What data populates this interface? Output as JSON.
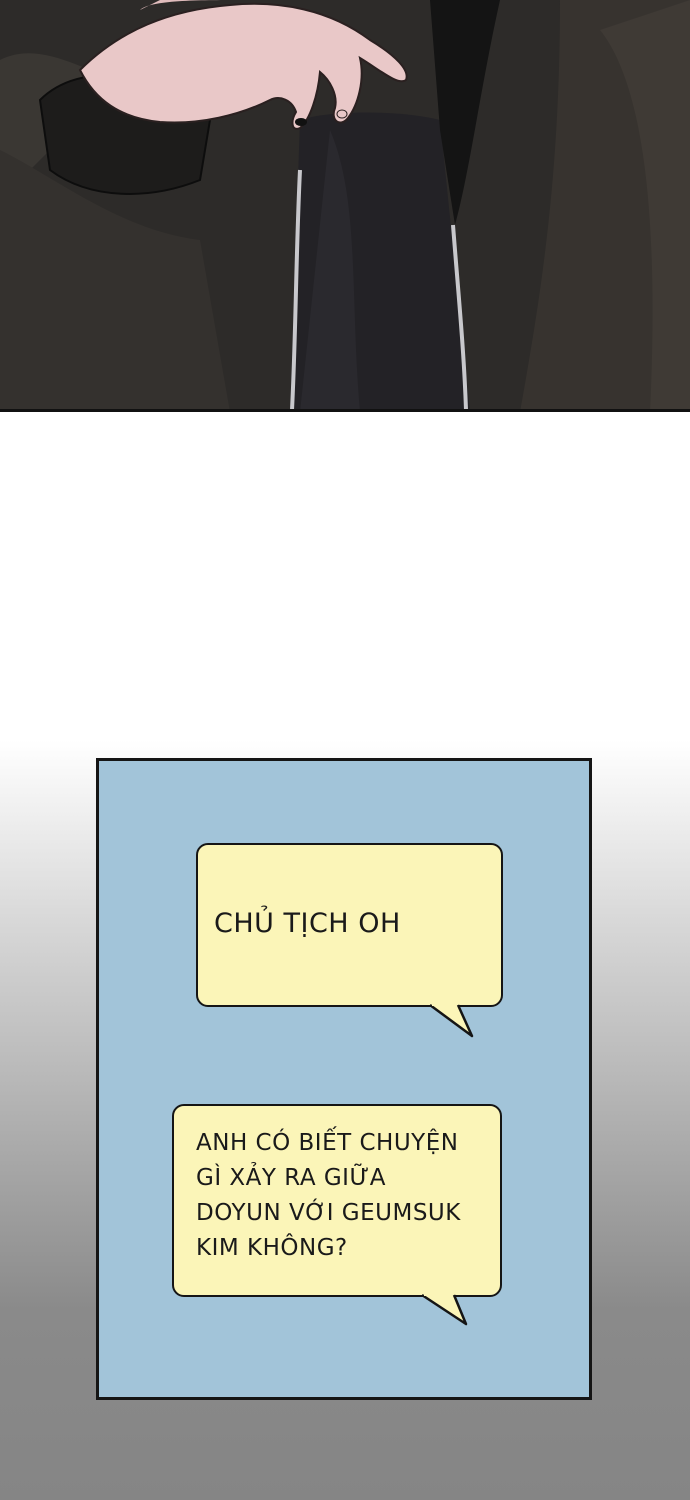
{
  "panels": {
    "top_image": {
      "icon": "hand-gripping-coat-illustration"
    },
    "speech_bubbles": [
      {
        "lines": [
          "CHỦ TỊCH OH"
        ]
      },
      {
        "lines": [
          "ANH CÓ BIẾT CHUYỆN",
          "GÌ XẢY RA GIỮA",
          "DOYUN VỚI GEUMSUK",
          "KIM KHÔNG?"
        ]
      }
    ]
  },
  "colors": {
    "panel_blue": "#a2c4d9",
    "bubble_yellow": "#fbf5b8",
    "coat_dark": "#2c2a28"
  }
}
